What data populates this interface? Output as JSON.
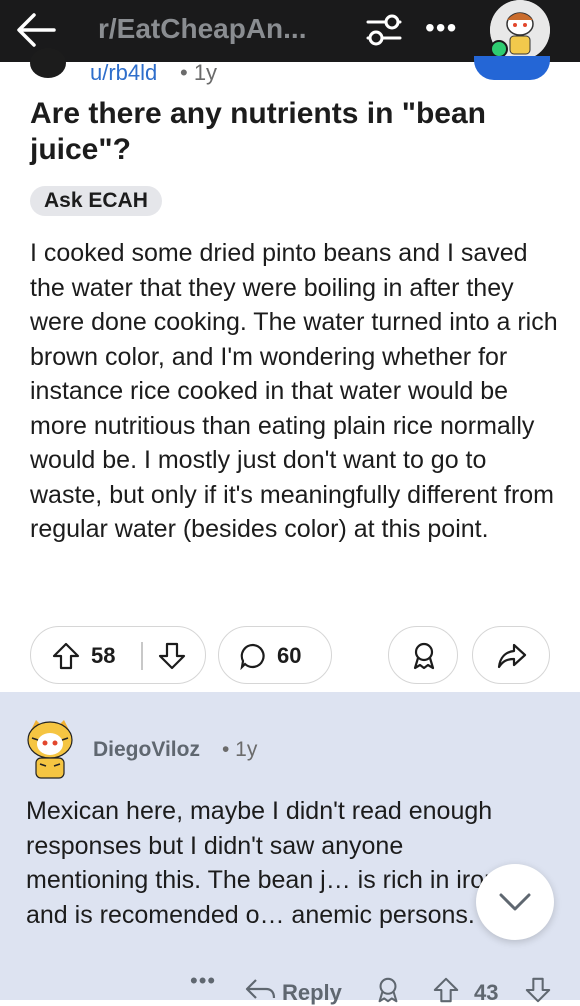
{
  "header": {
    "subreddit": "r/EatCheapAn...",
    "more_label": "•••"
  },
  "post": {
    "author": "u/rb4ld",
    "age": "• 1y",
    "title": "Are there any nutrients in \"bean juice\"?",
    "flair": "Ask ECAH",
    "body": "I cooked some dried pinto beans and I saved the water that they were boiling in after they were done cooking. The water turned into a rich brown color, and I'm wondering whether for instance rice cooked in that water would be more nutritious than eating plain rice normally would be. I mostly just don't want to go to waste, but only if it's meaningfully different from regular water (besides color) at this point.",
    "score": "58",
    "comment_count": "60"
  },
  "comment": {
    "author": "DiegoViloz",
    "age": "• 1y",
    "body": "Mexican here, maybe I didn't read enough responses  but I didn't saw anyone mentioning this. The bean j… is rich in iron and is recomended o… anemic persons.",
    "more_label": "•••",
    "reply_label": "Reply",
    "score": "43"
  },
  "colors": {
    "topbar": "#1a1a1b",
    "link_blue": "#2e6ecb",
    "comment_highlight": "#dde3f1",
    "online": "#2ecc71"
  },
  "icons": [
    "back-arrow-icon",
    "filter-icon",
    "more-icon",
    "upvote-icon",
    "downvote-icon",
    "comment-icon",
    "award-icon",
    "share-icon",
    "reply-icon",
    "chevron-down-icon"
  ]
}
